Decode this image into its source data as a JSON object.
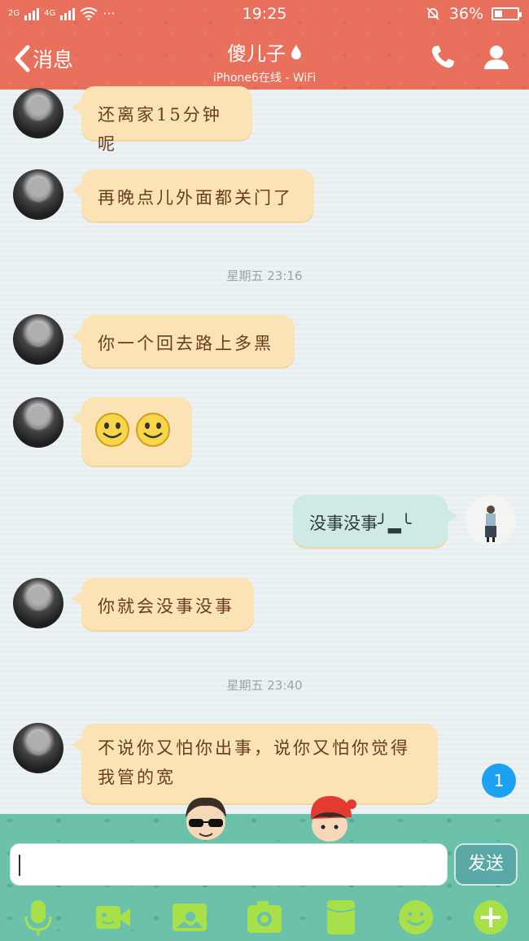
{
  "status_bar": {
    "net1": "2G",
    "net2": "4G",
    "dots": "···",
    "time": "19:25",
    "battery_text": "36%",
    "battery_level": 0.36
  },
  "header": {
    "back_label": "消息",
    "title": "傻儿子",
    "subtitle": "iPhone6在线 - WiFi"
  },
  "messages": [
    {
      "side": "in",
      "text": "还离家15分钟呢"
    },
    {
      "side": "in",
      "text": "再晚点儿外面都关门了"
    },
    {
      "type": "time",
      "text": "星期五 23:16"
    },
    {
      "side": "in",
      "text": "你一个回去路上多黑"
    },
    {
      "side": "in",
      "emoji": [
        "smile",
        "smile"
      ]
    },
    {
      "side": "out",
      "text": "没事没事╯▂╰"
    },
    {
      "side": "in",
      "text": "你就会没事没事"
    },
    {
      "type": "time",
      "text": "星期五 23:40"
    },
    {
      "side": "in",
      "text_line1": "不说你又怕你出事，说你又怕你觉得",
      "text_line2": "我管的宽"
    }
  ],
  "unread_badge": "1",
  "composer": {
    "placeholder": "",
    "send_label": "发送"
  },
  "toolbar": {
    "icons": [
      "mic-icon",
      "video-icon",
      "image-icon",
      "camera-icon",
      "file-icon",
      "emoji-icon",
      "plus-icon"
    ],
    "accent": "#a8e04a"
  },
  "colors": {
    "header_bg": "#e8705c",
    "bubble_in": "#fbe3b6",
    "bubble_out": "#cfe9e4",
    "bottom_bg": "#6cc1aa",
    "badge": "#1da1f2"
  }
}
